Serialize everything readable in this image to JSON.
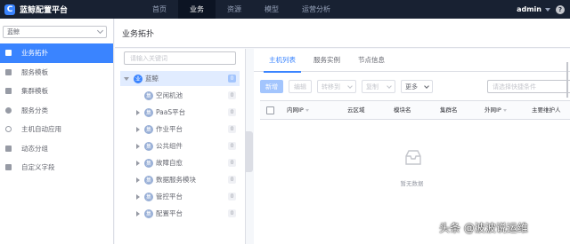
{
  "app": {
    "title": "蓝鲸配置平台",
    "logo_letter": "C",
    "brand_color": "#3a84ff"
  },
  "nav": {
    "items": [
      "首页",
      "业务",
      "资源",
      "模型",
      "运营分析"
    ],
    "active": "业务",
    "user": "admin",
    "help_glyph": "?"
  },
  "sidebar": {
    "business_select": "蓝鲸",
    "items": [
      {
        "label": "业务拓扑",
        "icon": "topology-icon",
        "active": true
      },
      {
        "label": "服务模板",
        "icon": "service-template-icon"
      },
      {
        "label": "集群模板",
        "icon": "cluster-template-icon"
      },
      {
        "label": "服务分类",
        "icon": "service-category-icon"
      },
      {
        "label": "主机自动应用",
        "icon": "host-auto-apply-icon"
      },
      {
        "label": "动态分组",
        "icon": "dynamic-group-icon"
      },
      {
        "label": "自定义字段",
        "icon": "custom-field-icon"
      }
    ]
  },
  "page": {
    "title": "业务拓扑"
  },
  "tree": {
    "search_placeholder": "请输入关键词",
    "root": {
      "badge": "业",
      "label": "蓝鲸",
      "count": "0"
    },
    "nodes": [
      {
        "badge": "集",
        "label": "空闲机池",
        "count": "0"
      },
      {
        "badge": "集",
        "label": "PaaS平台",
        "count": "0"
      },
      {
        "badge": "集",
        "label": "作业平台",
        "count": "0"
      },
      {
        "badge": "集",
        "label": "公共组件",
        "count": "0"
      },
      {
        "badge": "集",
        "label": "故障自愈",
        "count": "0"
      },
      {
        "badge": "集",
        "label": "数据服务模块",
        "count": "0"
      },
      {
        "badge": "集",
        "label": "管控平台",
        "count": "0"
      },
      {
        "badge": "集",
        "label": "配置平台",
        "count": "0"
      }
    ]
  },
  "content": {
    "tabs": [
      "主机列表",
      "服务实例",
      "节点信息"
    ],
    "active_tab": "主机列表",
    "toolbar": {
      "add": "新增",
      "edit": "编辑",
      "transfer": "转移到",
      "copy": "复制",
      "more": "更多"
    },
    "filter_placeholder": "请选择快捷条件",
    "columns": [
      "内网IP",
      "云区域",
      "模块名",
      "集群名",
      "外网IP",
      "主要维护人"
    ],
    "empty_text": "暂无数据"
  },
  "watermark": "头条 @波波说运维"
}
